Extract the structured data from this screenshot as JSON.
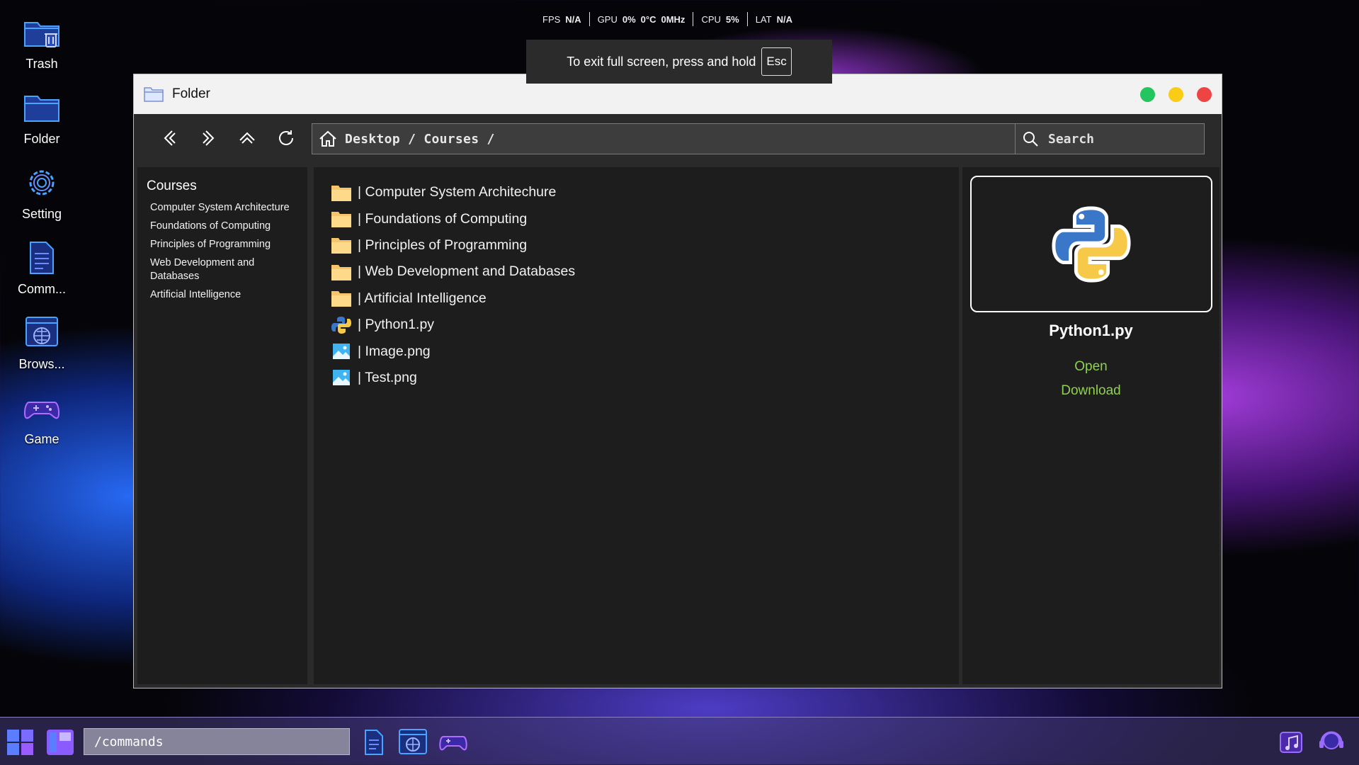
{
  "overlay": {
    "fps_label": "FPS",
    "fps_value": "N/A",
    "gpu_label": "GPU",
    "gpu_usage": "0%",
    "gpu_temp": "0°C",
    "gpu_clock": "0MHz",
    "cpu_label": "CPU",
    "cpu_value": "5%",
    "lat_label": "LAT",
    "lat_value": "N/A"
  },
  "fullscreen_toast": {
    "text": "To exit full screen, press and hold",
    "key": "Esc"
  },
  "desktop_icons": [
    {
      "label": "Trash",
      "icon": "trash-folder-icon"
    },
    {
      "label": "Folder",
      "icon": "folder-icon"
    },
    {
      "label": "Setting",
      "icon": "gear-icon"
    },
    {
      "label": "Comm...",
      "icon": "document-icon"
    },
    {
      "label": "Brows...",
      "icon": "browser-globe-icon"
    },
    {
      "label": "Game",
      "icon": "gamepad-icon"
    }
  ],
  "window": {
    "title": "Folder",
    "controls": {
      "colors": [
        "#22c55e",
        "#facc15",
        "#ef4444"
      ]
    },
    "address": {
      "path": "Desktop / Courses /"
    },
    "search": {
      "placeholder": "Search"
    },
    "sidebar": {
      "heading": "Courses",
      "items": [
        "Computer System Architecture",
        "Foundations of Computing",
        "Principles of Programming",
        "Web Development and Databases",
        "Artificial Intelligence"
      ]
    },
    "files": [
      {
        "name": "| Computer System Architechure",
        "type": "folder"
      },
      {
        "name": "| Foundations of Computing",
        "type": "folder"
      },
      {
        "name": "| Principles of Programming",
        "type": "folder"
      },
      {
        "name": "| Web Development and Databases",
        "type": "folder"
      },
      {
        "name": "| Artificial Intelligence",
        "type": "folder"
      },
      {
        "name": "| Python1.py",
        "type": "python"
      },
      {
        "name": "| Image.png",
        "type": "image"
      },
      {
        "name": "| Test.png",
        "type": "image"
      }
    ],
    "preview": {
      "filename": "Python1.py",
      "open_label": "Open",
      "download_label": "Download",
      "action_color": "#8fd14f"
    }
  },
  "taskbar": {
    "command_value": "/commands"
  }
}
